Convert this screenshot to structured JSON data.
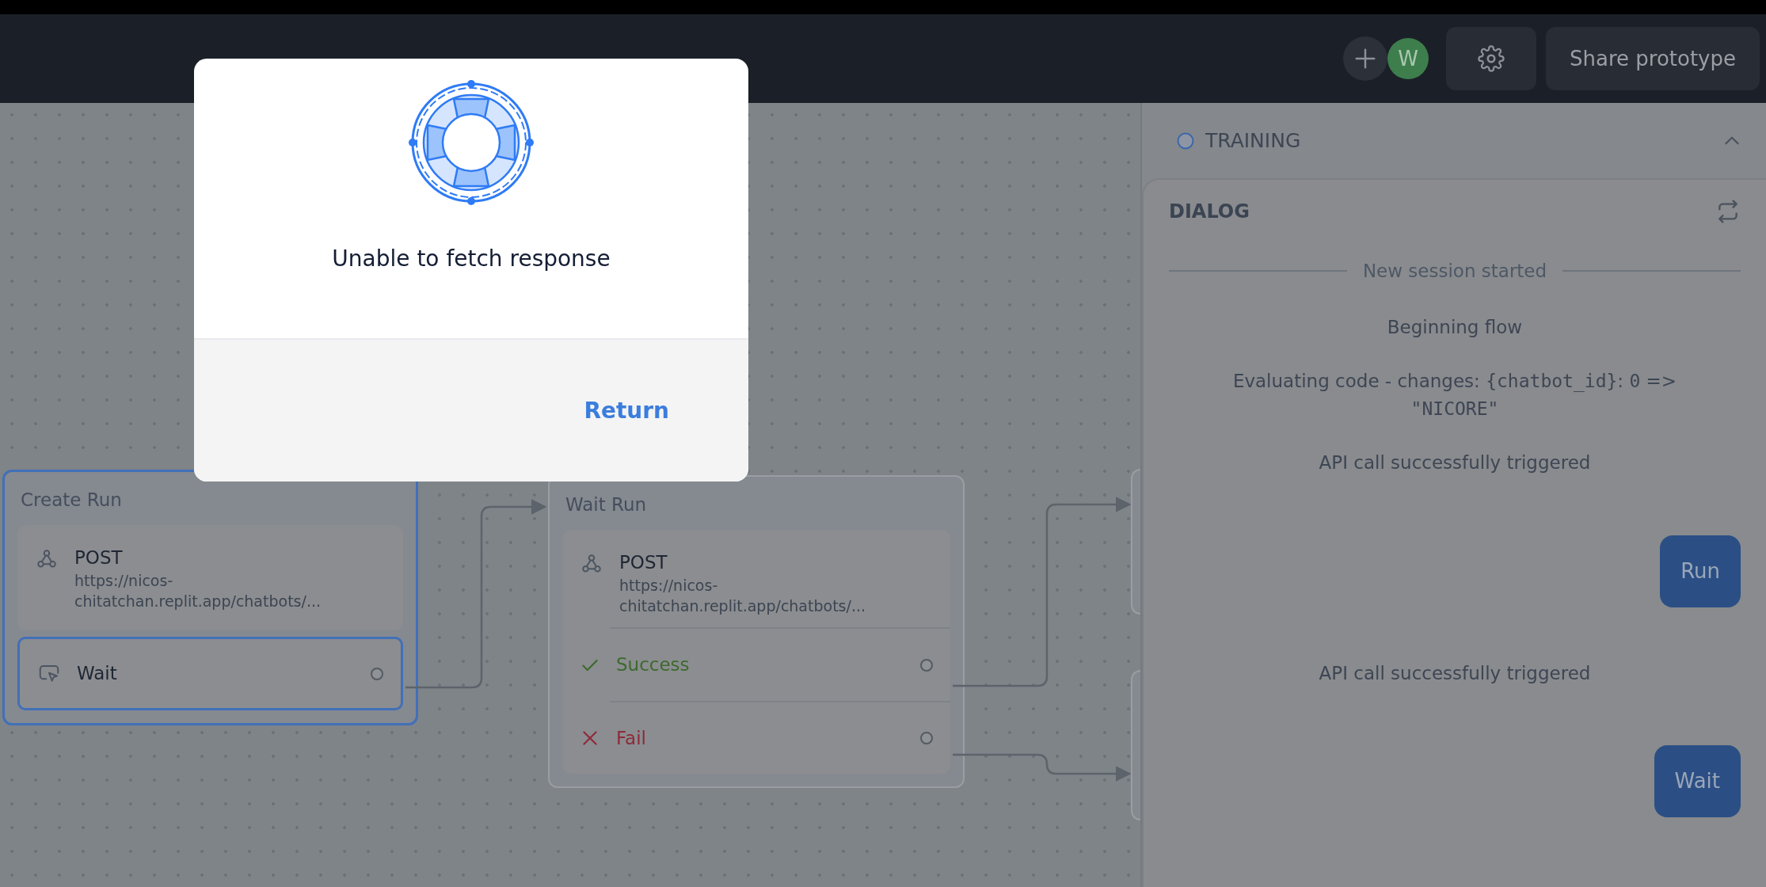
{
  "header": {
    "avatar": {
      "initial": "W"
    },
    "share_button": "Share prototype"
  },
  "canvas": {
    "blocks": [
      {
        "title": "Create Run",
        "selected": true,
        "steps": [
          {
            "kind": "api",
            "method": "POST",
            "url": "https://nicos-chitatchan.replit.app/chatbots/...",
            "selected": false
          },
          {
            "kind": "wait",
            "label": "Wait",
            "selected": true
          }
        ]
      },
      {
        "title": "Wait Run",
        "selected": false,
        "steps": [
          {
            "kind": "api",
            "method": "POST",
            "url": "https://nicos-chitatchan.replit.app/chatbots/...",
            "selected": false
          },
          {
            "kind": "success",
            "label": "Success",
            "selected": false
          },
          {
            "kind": "fail",
            "label": "Fail",
            "selected": false
          }
        ]
      }
    ]
  },
  "panel": {
    "section": "TRAINING",
    "expanded": true,
    "dialog": {
      "title": "DIALOG",
      "messages": [
        {
          "kind": "divider",
          "text": "New session started"
        },
        {
          "kind": "system",
          "text": "Beginning flow"
        },
        {
          "kind": "code",
          "parts": [
            {
              "text": "Evaluating code - changes: ",
              "mono": false
            },
            {
              "text": "{chatbot_id}",
              "mono": true
            },
            {
              "text": ": ",
              "mono": false
            },
            {
              "text": "0",
              "mono": true
            },
            {
              "text": " => ",
              "mono": false
            },
            {
              "text": "\"NICORE\"",
              "mono": true
            }
          ]
        },
        {
          "kind": "system",
          "text": "API call successfully triggered"
        },
        {
          "kind": "user",
          "text": "Run"
        },
        {
          "kind": "system",
          "text": "API call successfully triggered"
        },
        {
          "kind": "user",
          "text": "Wait"
        }
      ]
    }
  },
  "modal": {
    "message": "Unable to fetch response",
    "action": "Return"
  }
}
